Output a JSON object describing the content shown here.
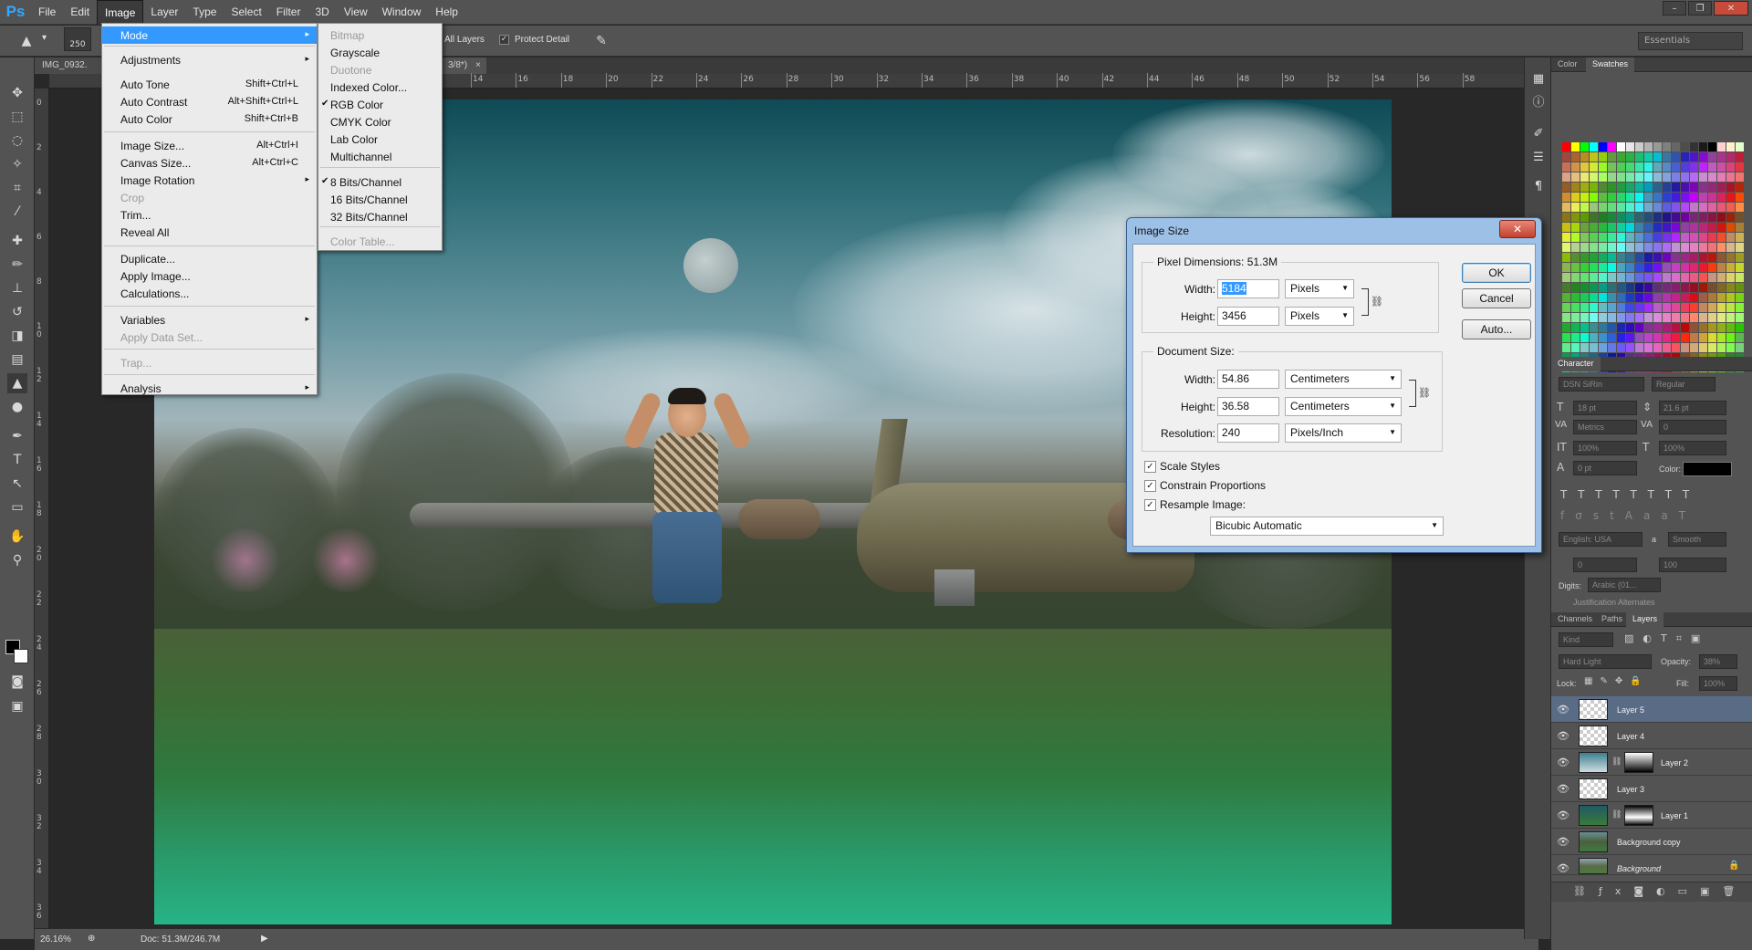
{
  "app": {
    "logo": "Ps",
    "menus": [
      "File",
      "Edit",
      "Image",
      "Layer",
      "Type",
      "Select",
      "Filter",
      "3D",
      "View",
      "Window",
      "Help"
    ],
    "window_controls": [
      "–",
      "❐",
      "✕"
    ]
  },
  "options_bar": {
    "brush_size": "250",
    "sample_all_layers_label": "All Layers",
    "protect_detail_label": "Protect Detail",
    "workspace": "Essentials"
  },
  "document": {
    "tab_title": "IMG_0932.",
    "tab_title_2": "3/8*)",
    "tab_close": "×",
    "zoom": "26.16%",
    "doc_info": "Doc: 51.3M/246.7M"
  },
  "ruler": {
    "top_labels": [
      "14",
      "16",
      "18",
      "20",
      "22",
      "24",
      "26",
      "28",
      "30",
      "32",
      "34",
      "36",
      "38",
      "40",
      "42",
      "44",
      "46",
      "48",
      "50",
      "52",
      "54",
      "56",
      "58"
    ],
    "left_labels": [
      "0",
      "2",
      "4",
      "6",
      "8",
      "1\n0",
      "1\n2",
      "1\n4",
      "1\n6",
      "1\n8",
      "2\n0",
      "2\n2",
      "2\n4",
      "2\n6",
      "2\n8",
      "3\n0",
      "3\n2",
      "3\n4",
      "3\n6"
    ]
  },
  "image_menu": {
    "items": [
      {
        "label": "Mode",
        "arrow": "▸",
        "highlighted": true
      },
      {
        "label": "Adjustments",
        "arrow": "▸"
      },
      {
        "label": "Auto Tone",
        "shortcut": "Shift+Ctrl+L"
      },
      {
        "label": "Auto Contrast",
        "shortcut": "Alt+Shift+Ctrl+L"
      },
      {
        "label": "Auto Color",
        "shortcut": "Shift+Ctrl+B"
      },
      {
        "label": "Image Size...",
        "shortcut": "Alt+Ctrl+I"
      },
      {
        "label": "Canvas Size...",
        "shortcut": "Alt+Ctrl+C"
      },
      {
        "label": "Image Rotation",
        "arrow": "▸"
      },
      {
        "label": "Crop",
        "disabled": true
      },
      {
        "label": "Trim..."
      },
      {
        "label": "Reveal All"
      },
      {
        "label": "Duplicate..."
      },
      {
        "label": "Apply Image..."
      },
      {
        "label": "Calculations..."
      },
      {
        "label": "Variables",
        "arrow": "▸"
      },
      {
        "label": "Apply Data Set...",
        "disabled": true
      },
      {
        "label": "Trap...",
        "disabled": true
      },
      {
        "label": "Analysis",
        "arrow": "▸"
      }
    ]
  },
  "mode_menu": {
    "items": [
      {
        "label": "Bitmap",
        "disabled": true
      },
      {
        "label": "Grayscale"
      },
      {
        "label": "Duotone",
        "disabled": true
      },
      {
        "label": "Indexed Color..."
      },
      {
        "label": "RGB Color",
        "checked": true
      },
      {
        "label": "CMYK Color"
      },
      {
        "label": "Lab Color"
      },
      {
        "label": "Multichannel"
      },
      {
        "label": "8 Bits/Channel",
        "checked": true
      },
      {
        "label": "16 Bits/Channel"
      },
      {
        "label": "32 Bits/Channel"
      },
      {
        "label": "Color Table...",
        "disabled": true
      }
    ]
  },
  "image_size_dialog": {
    "title": "Image Size",
    "close": "✕",
    "pixel_dimensions_label": "Pixel Dimensions:",
    "pixel_dimensions_value": "51.3M",
    "width_label": "Width:",
    "height_label": "Height:",
    "pixel_width": "5184",
    "pixel_height": "3456",
    "pixel_unit": "Pixels",
    "document_size_label": "Document Size:",
    "doc_width": "54.86",
    "doc_height": "36.58",
    "doc_unit": "Centimeters",
    "resolution_label": "Resolution:",
    "resolution": "240",
    "resolution_unit": "Pixels/Inch",
    "scale_styles": "Scale Styles",
    "constrain_proportions": "Constrain Proportions",
    "resample_image": "Resample Image:",
    "resample_method": "Bicubic Automatic",
    "ok": "OK",
    "cancel": "Cancel",
    "auto": "Auto...",
    "check_mark": "✓"
  },
  "panels": {
    "color_tabs": [
      "Color",
      "Swatches"
    ],
    "character_tab": "Character",
    "font_family": "DSN SiRin",
    "font_style": "Regular",
    "font_size": "18 pt",
    "leading": "21.6 pt",
    "kerning": "Metrics",
    "tracking": "0",
    "vscale": "100%",
    "hscale": "100%",
    "baseline": "0 pt",
    "color_label": "Color:",
    "language": "English: USA",
    "aa_label": "a",
    "antialias": "Smooth",
    "field_0": "0",
    "field_100": "100",
    "digits_label": "Digits:",
    "digits_value": "Arabic (01...",
    "justification": "Justification Alternates",
    "layer_tabs": [
      "Channels",
      "Paths",
      "Layers"
    ],
    "kind_label": "Kind",
    "blend_mode": "Hard Light",
    "opacity_label": "Opacity:",
    "opacity": "38%",
    "lock_label": "Lock:",
    "fill_label": "Fill:",
    "fill": "100%",
    "layers": [
      {
        "name": "Layer 5",
        "selected": true,
        "mask": false
      },
      {
        "name": "Layer 4",
        "mask": false
      },
      {
        "name": "Layer 2",
        "mask": true
      },
      {
        "name": "Layer 3",
        "mask": false
      },
      {
        "name": "Layer 1",
        "mask": true
      },
      {
        "name": "Background copy",
        "mask": false
      },
      {
        "name": "Background",
        "mask": false
      }
    ]
  },
  "colors": {
    "accent": "#3399ff",
    "panel_bg": "#535353",
    "dialog_frame": "#9cc0e6"
  },
  "swatch_colors": [
    "#ff0000",
    "#ffff00",
    "#00ff00",
    "#00ffff",
    "#0000ff",
    "#ff00ff",
    "#ffffff",
    "#e6e6e6",
    "#cccccc",
    "#b3b3b3",
    "#999999",
    "#808080",
    "#666666",
    "#4d4d4d",
    "#333333",
    "#1a1a1a",
    "#000000",
    "#ffd1d1",
    "#fff2cc",
    "#e5ffcc"
  ]
}
